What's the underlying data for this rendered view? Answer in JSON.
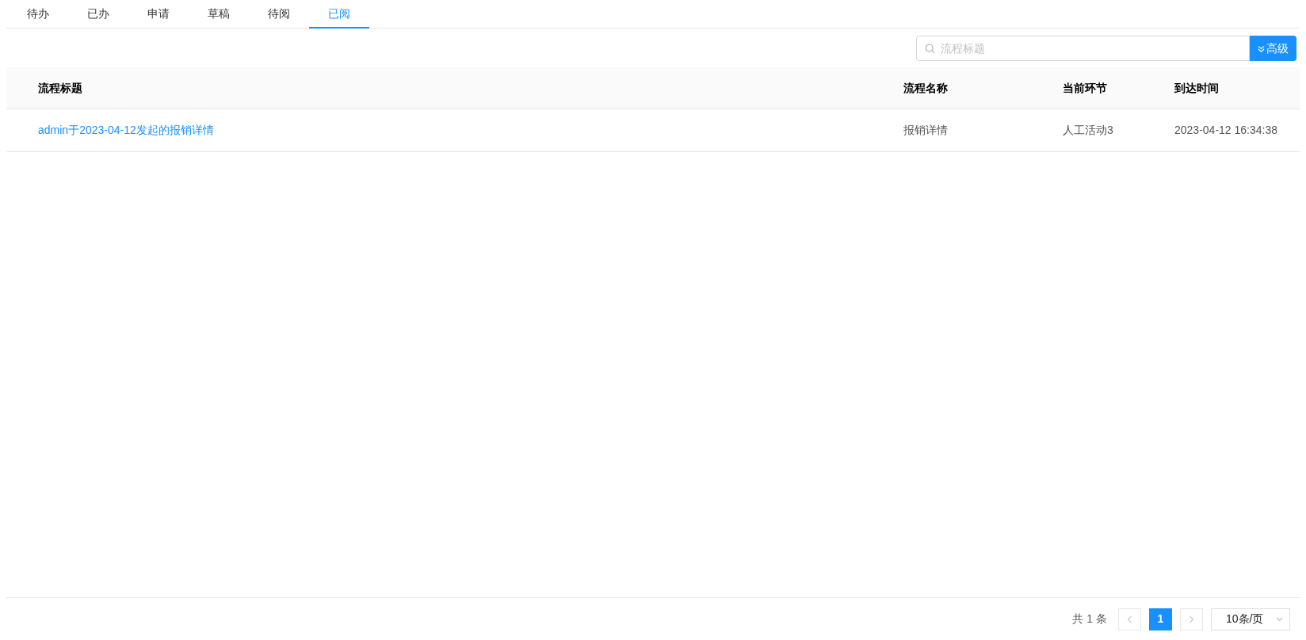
{
  "tabs": [
    {
      "label": "待办",
      "selected": false
    },
    {
      "label": "已办",
      "selected": false
    },
    {
      "label": "申请",
      "selected": false
    },
    {
      "label": "草稿",
      "selected": false
    },
    {
      "label": "待阅",
      "selected": false
    },
    {
      "label": "已阅",
      "selected": true
    }
  ],
  "search": {
    "placeholder": "流程标题",
    "advanced_button": "高级"
  },
  "table": {
    "columns": [
      "流程标题",
      "流程名称",
      "当前环节",
      "到达时间"
    ],
    "rows": [
      {
        "title": "admin于2023-04-12发起的报销详情",
        "process_name": "报销详情",
        "current_step": "人工活动3",
        "arrival_time": "2023-04-12 16:34:38"
      }
    ]
  },
  "pagination": {
    "total": "共 1 条",
    "prev_disabled": true,
    "next_disabled": true,
    "pages": [
      {
        "label": "1",
        "selected": true
      }
    ],
    "page_size": "10条/页"
  }
}
